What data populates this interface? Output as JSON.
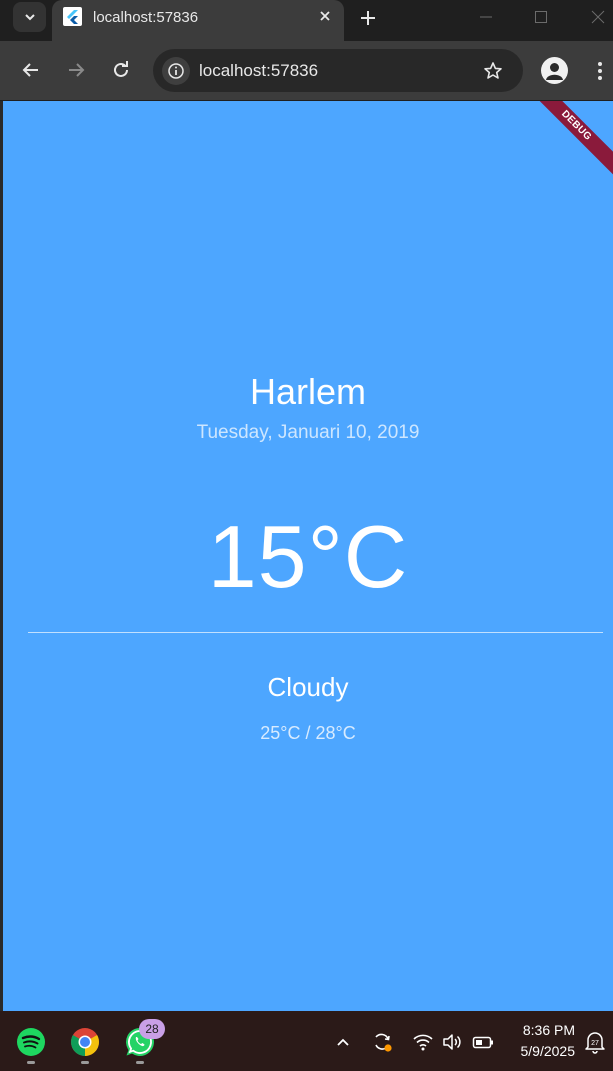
{
  "browser": {
    "tab_title": "localhost:57836",
    "url": "localhost:57836",
    "close_glyph": "✕",
    "newtab_glyph": "+"
  },
  "page": {
    "debug_banner": "DEBUG",
    "city": "Harlem",
    "date": "Tuesday, Januari 10, 2019",
    "temperature": "15°C",
    "condition": "Cloudy",
    "temp_range": "25°C / 28°C",
    "background_color": "#4da6ff"
  },
  "taskbar": {
    "apps": [
      "spotify-icon",
      "chrome-icon",
      "whatsapp-icon"
    ],
    "whatsapp_badge": "28",
    "time": "8:36 PM",
    "date": "5/9/2025",
    "notification_count": "27"
  }
}
